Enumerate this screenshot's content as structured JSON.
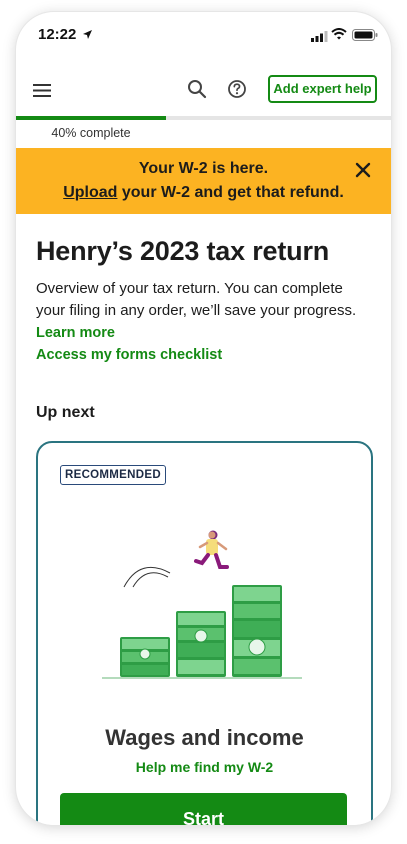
{
  "status_bar": {
    "time": "12:22"
  },
  "header": {
    "expert_help_label": "Add expert help"
  },
  "progress": {
    "percent": 40,
    "label": "40% complete"
  },
  "banner": {
    "line1": "Your W-2 is here.",
    "link_text": "Upload",
    "line2_rest": " your W-2 and get that refund."
  },
  "main": {
    "title": "Henry’s 2023 tax return",
    "description": "Overview of your tax return. You can complete your filing in any order, we’ll save your progress.",
    "learn_more": "Learn more",
    "forms_checklist": "Access my forms checklist",
    "up_next_heading": "Up next"
  },
  "card": {
    "badge": "RECOMMENDED",
    "title": "Wages and income",
    "help_link": "Help me find my W-2",
    "start_label": "Start"
  },
  "colors": {
    "accent_green": "#148a14",
    "banner_yellow": "#fcb322",
    "card_border": "#2a7480"
  }
}
